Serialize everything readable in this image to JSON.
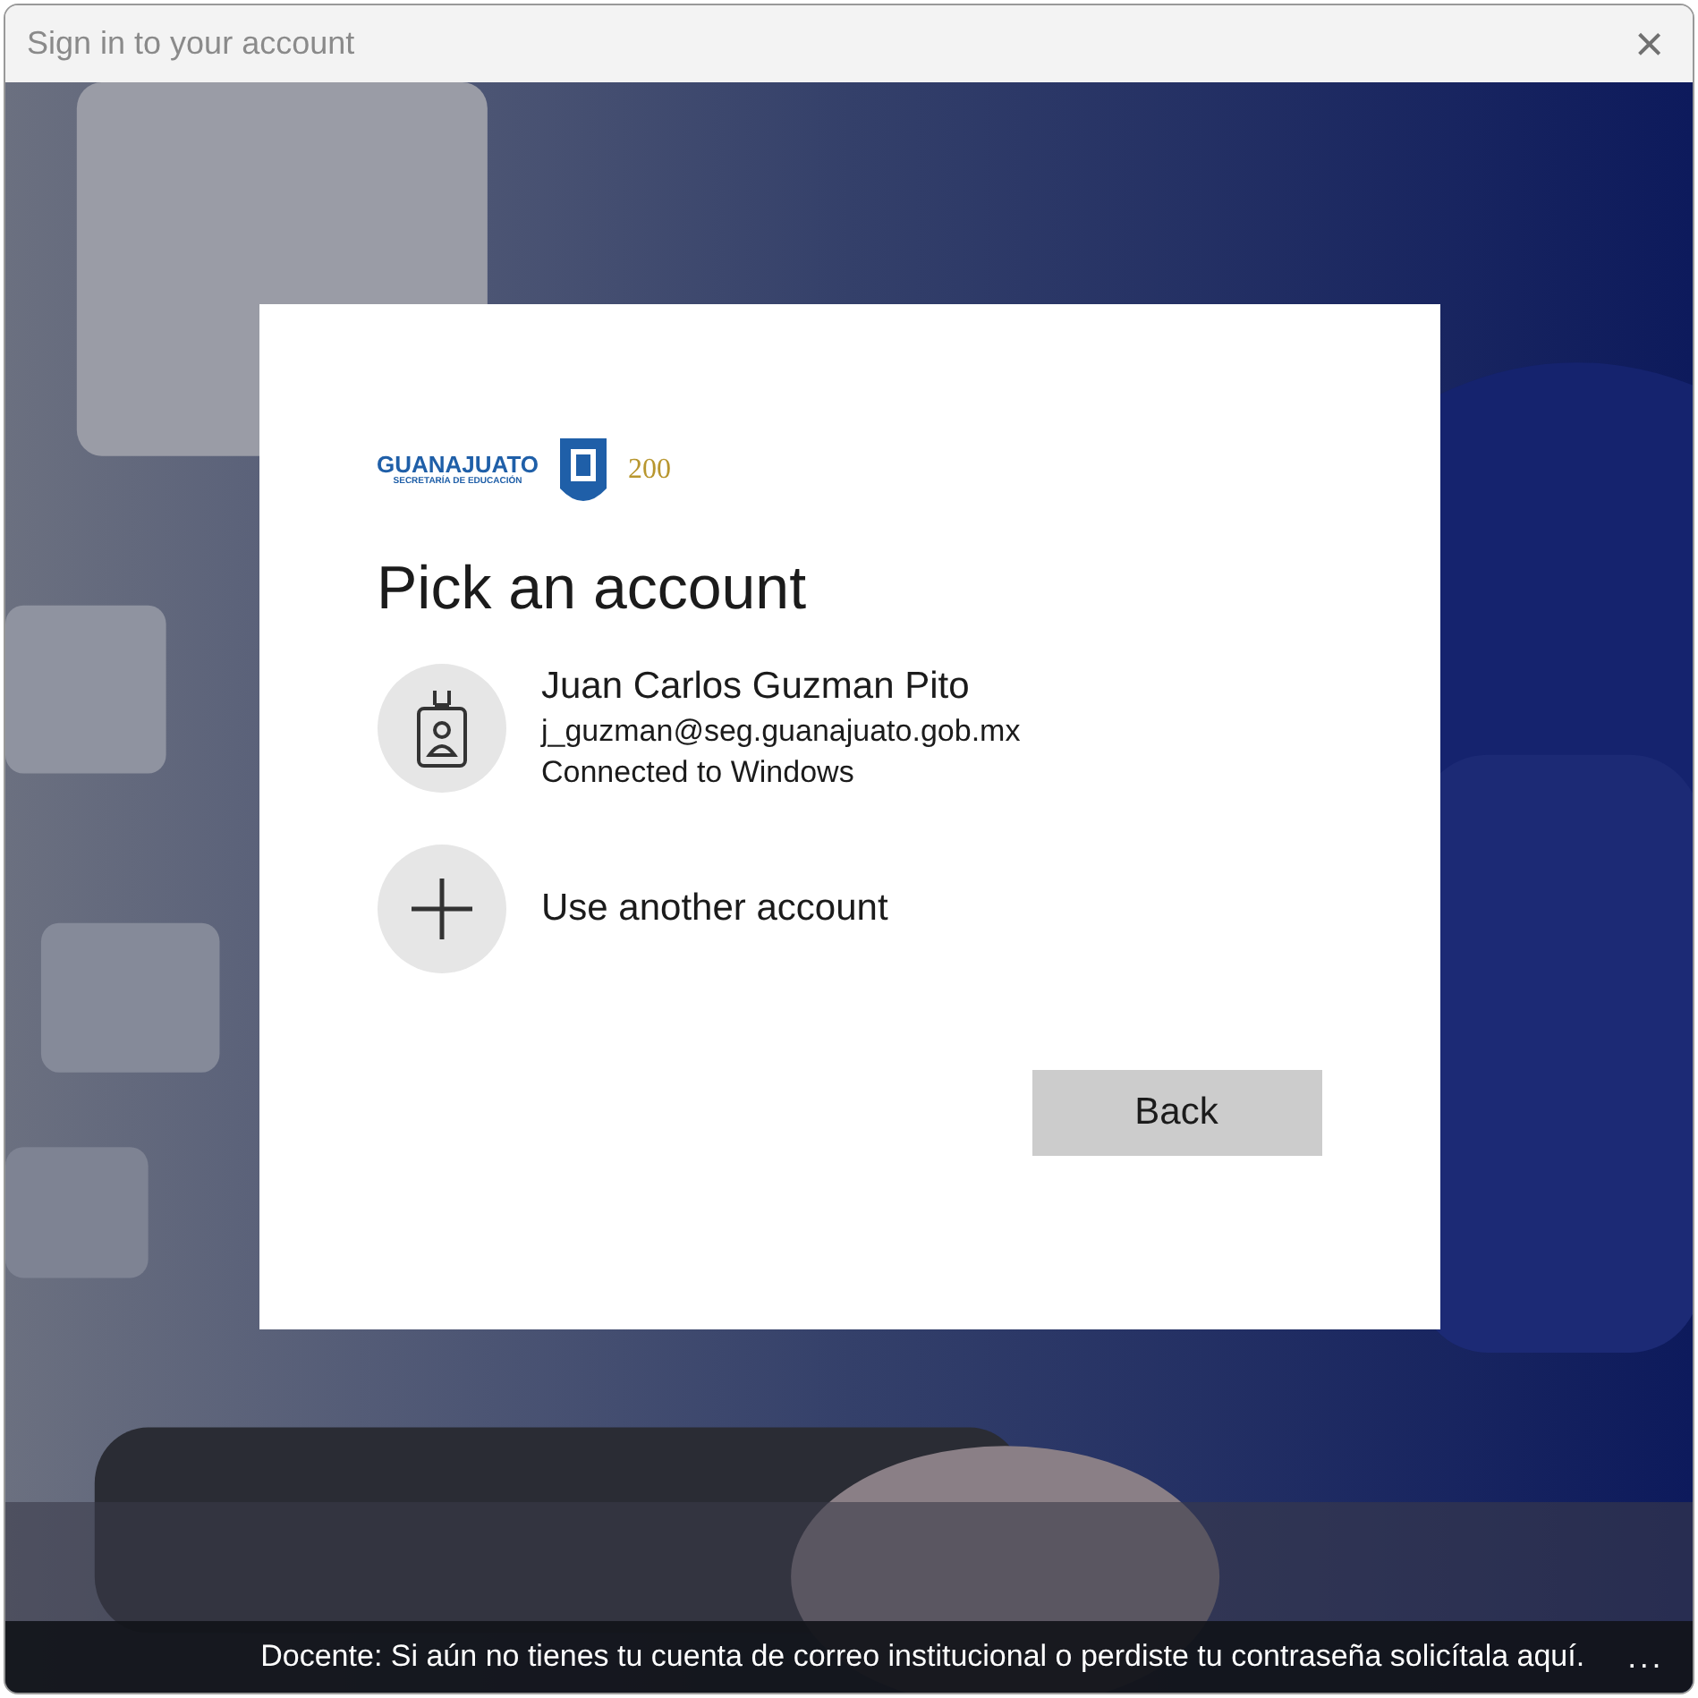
{
  "window": {
    "title": "Sign in to your account",
    "close": "×"
  },
  "logo": {
    "name": "GUANAJUATO",
    "subtitle": "SECRETARÍA DE EDUCACIÓN",
    "anniversary": "200"
  },
  "heading": "Pick an account",
  "accounts": [
    {
      "kind": "account",
      "name": "Juan Carlos Guzman Pito",
      "email": "j_guzman@seg.guanajuato.gob.mx",
      "status": "Connected to Windows"
    },
    {
      "kind": "add",
      "name": "Use another account"
    }
  ],
  "buttons": [
    "Back"
  ],
  "footer": {
    "text": "Docente: Si aún no tienes tu cuenta de correo institucional o perdiste tu contraseña solicítala aquí.",
    "more": "..."
  }
}
